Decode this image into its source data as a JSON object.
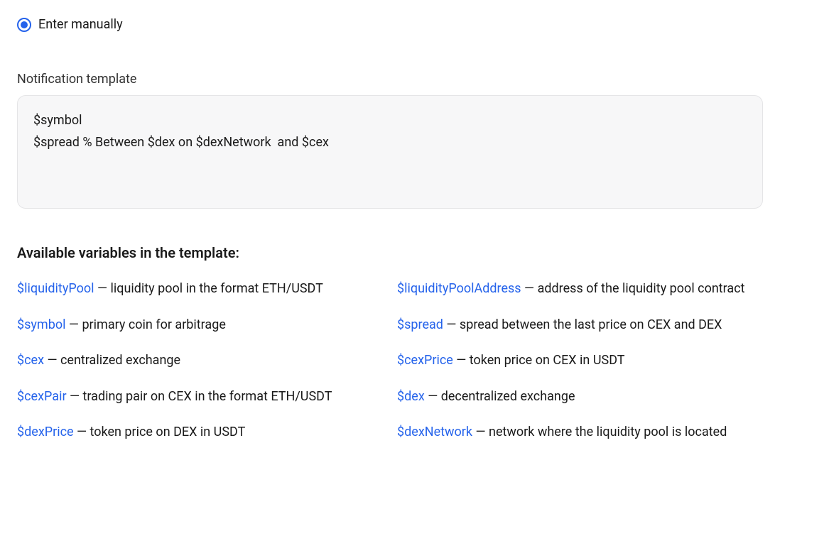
{
  "radio": {
    "label": "Enter manually",
    "selected": true
  },
  "template_field": {
    "label": "Notification template",
    "value": "$symbol\n$spread % Between $dex on $dexNetwork  and $cex"
  },
  "variables": {
    "heading": "Available variables in the template:",
    "items": [
      {
        "name": "$liquidityPool",
        "desc": " — liquidity pool in the format ETH/USDT"
      },
      {
        "name": "$liquidityPoolAddress",
        "desc": " — address of the liquidity pool contract"
      },
      {
        "name": "$symbol",
        "desc": " — primary coin for arbitrage"
      },
      {
        "name": "$spread",
        "desc": " — spread between the last price on CEX and DEX"
      },
      {
        "name": "$cex",
        "desc": " — centralized exchange"
      },
      {
        "name": "$cexPrice",
        "desc": " — token price on CEX in USDT"
      },
      {
        "name": "$cexPair",
        "desc": " — trading pair on CEX in the format ETH/USDT"
      },
      {
        "name": "$dex",
        "desc": " — decentralized exchange"
      },
      {
        "name": "$dexPrice",
        "desc": " — token price on DEX in USDT"
      },
      {
        "name": "$dexNetwork",
        "desc": " — network where the liquidity pool is located"
      }
    ]
  }
}
